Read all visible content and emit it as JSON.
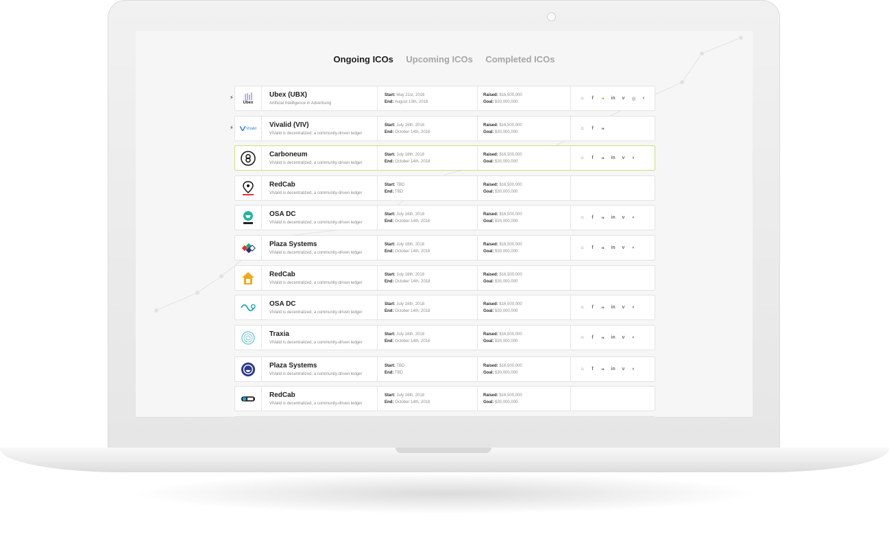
{
  "tabs": [
    {
      "label": "Ongoing ICOs",
      "active": true
    },
    {
      "label": "Upcoming ICOs",
      "active": false
    },
    {
      "label": "Completed ICOs",
      "active": false
    }
  ],
  "labels": {
    "start": "Start:",
    "end": "End:",
    "raised": "Raised:",
    "goal": "Goal:"
  },
  "colors": {
    "accent": "#8cc63f",
    "text": "#1d1d1d",
    "muted": "#8d8d8d",
    "border": "#e3e3e3"
  },
  "rows": [
    {
      "name": "Ubex (UBX)",
      "desc": "Artificial Intelligence in Advertising",
      "logo": "ubex-logo",
      "logo_text": "Ubex",
      "start": "May 21st, 2018",
      "end": "August 13th, 2018",
      "raised": "$16,500,000",
      "goal": "$30,000,000",
      "socials": [
        "home",
        "facebook",
        "twitter",
        "linkedin",
        "vimeo",
        "instagram",
        "github"
      ],
      "bolt": true,
      "highlight": false
    },
    {
      "name": "Vivalid (VIV)",
      "desc": "ViValid is decentralized, a community-driven ledger",
      "logo": "vivalid-logo",
      "logo_text": "ViValid",
      "start": "July 16th, 2018",
      "end": "October 14th, 2018",
      "raised": "$16,500,000",
      "goal": "$30,000,000",
      "socials": [
        "home",
        "facebook",
        "twitter"
      ],
      "bolt": true,
      "highlight": false
    },
    {
      "name": "Carboneum",
      "desc": "ViValid is decentralized, a community-driven ledger",
      "logo": "carboneum-logo",
      "start": "July 16th, 2018",
      "end": "October 14th, 2018",
      "raised": "$16,500,000",
      "goal": "$30,000,000",
      "socials": [
        "home",
        "facebook",
        "twitter",
        "linkedin",
        "vimeo",
        "github"
      ],
      "bolt": false,
      "highlight": true
    },
    {
      "name": "RedCab",
      "desc": "ViValid is decentralized, a community-driven ledger",
      "logo": "redcab-logo",
      "start": "TBD",
      "end": "TBD",
      "raised": "$16,500,000",
      "goal": "$30,000,000",
      "socials": [],
      "bolt": false,
      "highlight": false
    },
    {
      "name": "OSA DC",
      "desc": "ViValid is decentralized, a community-driven ledger",
      "logo": "osa-logo",
      "start": "July 16th, 2018",
      "end": "October 14th, 2018",
      "raised": "$16,500,000",
      "goal": "$30,000,000",
      "socials": [
        "home",
        "facebook",
        "twitter",
        "linkedin",
        "vimeo",
        "github"
      ],
      "bolt": false,
      "highlight": false
    },
    {
      "name": "Plaza Systems",
      "desc": "ViValid is decentralized, a community-driven ledger",
      "logo": "plaza-logo",
      "start": "July 16th, 2018",
      "end": "October 14th, 2018",
      "raised": "$16,500,000",
      "goal": "$30,000,000",
      "socials": [
        "home",
        "facebook",
        "twitter",
        "linkedin",
        "vimeo",
        "github"
      ],
      "bolt": false,
      "highlight": false
    },
    {
      "name": "RedCab",
      "desc": "ViValid is decentralized, a community-driven ledger",
      "logo": "house-logo",
      "start": "July 16th, 2018",
      "end": "October 14th, 2018",
      "raised": "$16,500,000",
      "goal": "$30,000,000",
      "socials": [],
      "bolt": false,
      "highlight": false
    },
    {
      "name": "OSA DC",
      "desc": "ViValid is decentralized, a community-driven ledger",
      "logo": "wave-logo",
      "start": "July 16th, 2018",
      "end": "October 14th, 2018",
      "raised": "$16,500,000",
      "goal": "$30,000,000",
      "socials": [
        "home",
        "facebook",
        "twitter",
        "linkedin",
        "vimeo",
        "github"
      ],
      "bolt": false,
      "highlight": false
    },
    {
      "name": "Traxia",
      "desc": "ViValid is decentralized, a community-driven ledger",
      "logo": "traxia-logo",
      "start": "July 16th, 2018",
      "end": "October 14th, 2018",
      "raised": "$16,500,000",
      "goal": "$30,000,000",
      "socials": [
        "home",
        "facebook",
        "twitter",
        "linkedin",
        "vimeo",
        "github"
      ],
      "bolt": false,
      "highlight": false
    },
    {
      "name": "Plaza Systems",
      "desc": "ViValid is decentralized, a community-driven ledger",
      "logo": "ship-logo",
      "start": "TBD",
      "end": "TBD",
      "raised": "$16,500,000",
      "goal": "$30,000,000",
      "socials": [
        "home",
        "facebook",
        "twitter",
        "linkedin",
        "vimeo",
        "github"
      ],
      "bolt": false,
      "highlight": false
    },
    {
      "name": "RedCab",
      "desc": "ViValid is decentralized, a community-driven ledger",
      "logo": "badge-logo",
      "start": "July 16th, 2018",
      "end": "October 14th, 2018",
      "raised": "$16,500,000",
      "goal": "$30,000,000",
      "socials": [],
      "bolt": false,
      "highlight": false
    }
  ]
}
